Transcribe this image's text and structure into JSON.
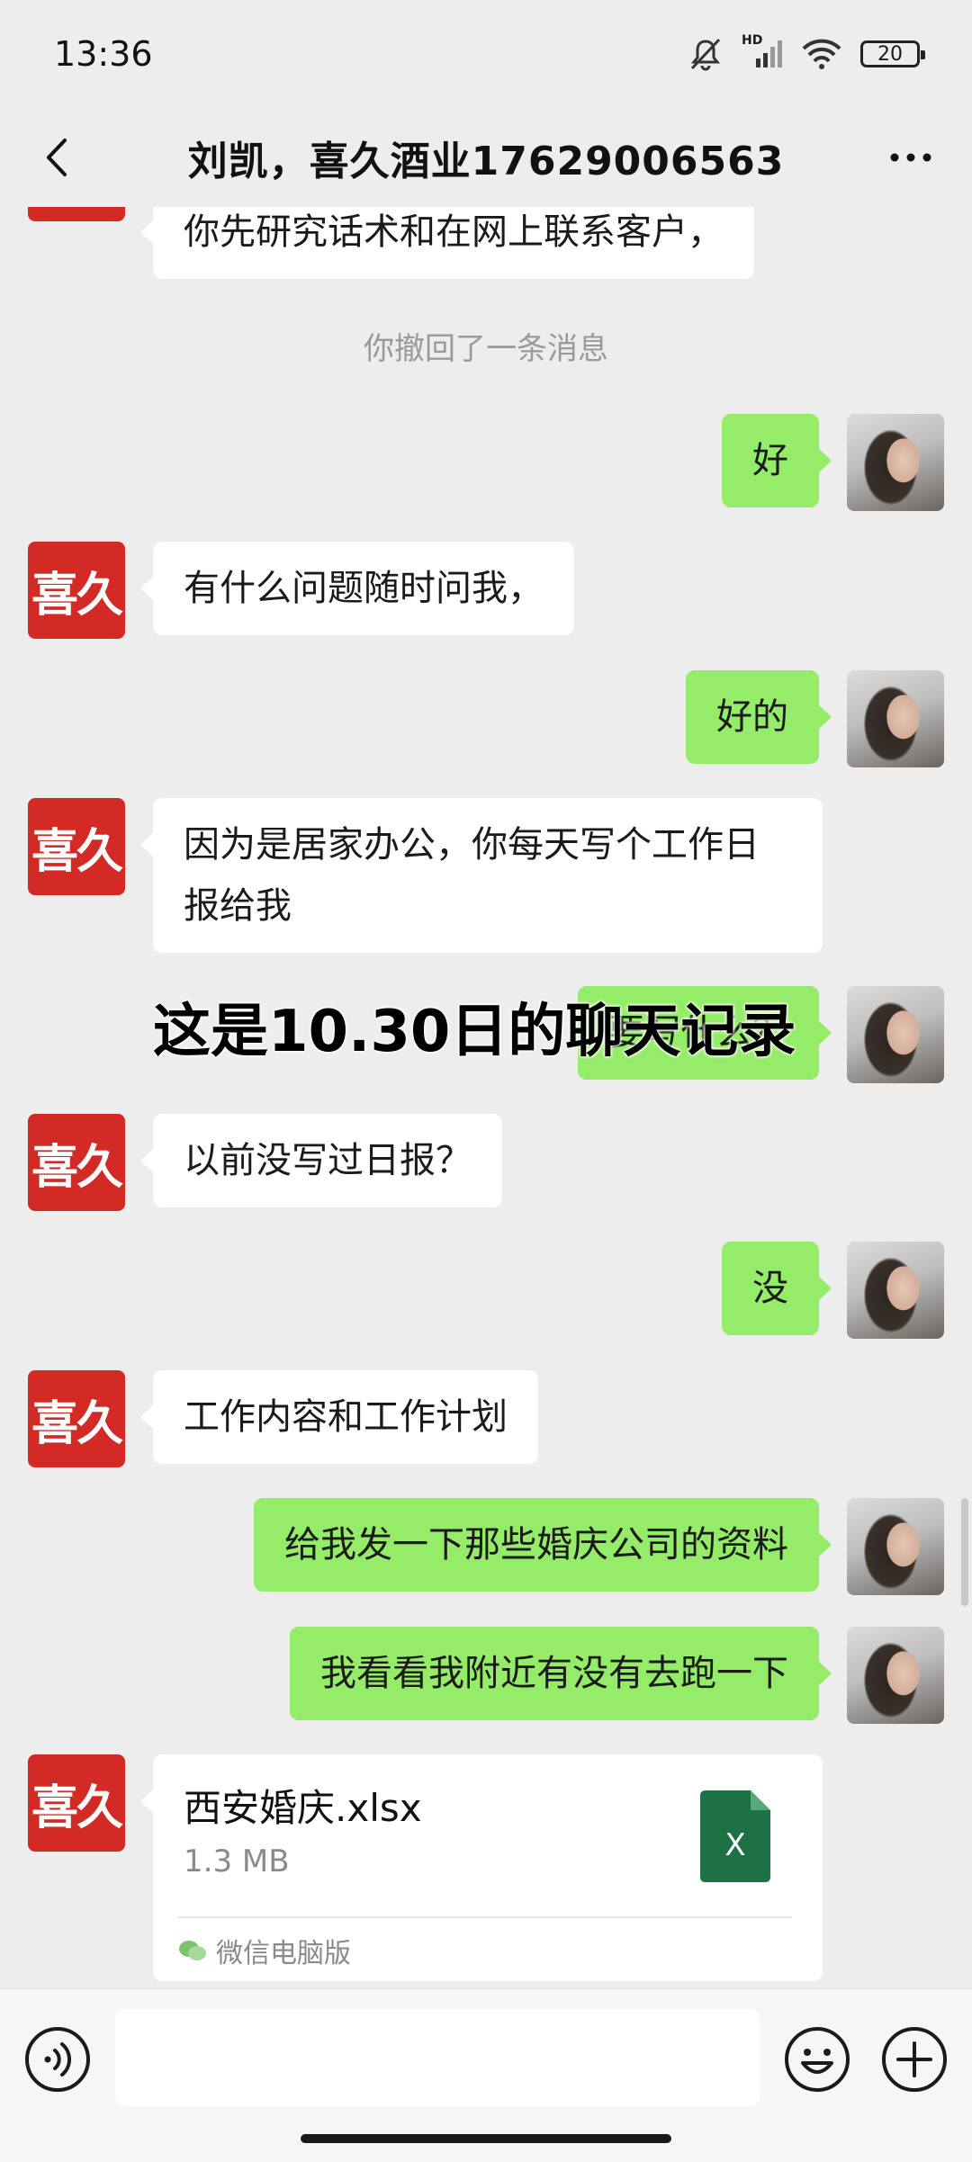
{
  "status_bar": {
    "time": "13:36",
    "network_label": "HD",
    "battery_level": "20",
    "icons": [
      "mute-icon",
      "signal-icon",
      "wifi-icon",
      "battery-icon"
    ]
  },
  "nav": {
    "title": "刘凯，喜久酒业17629006563",
    "back_icon": "chevron-left-icon",
    "more_icon": "more-dots-icon"
  },
  "contact_avatar_text": "喜久",
  "messages": [
    {
      "from": "other",
      "text": "你先研究话术和在网上联系客户，"
    },
    {
      "from": "system",
      "text": "你撤回了一条消息"
    },
    {
      "from": "me",
      "text": "好"
    },
    {
      "from": "other",
      "text": "有什么问题随时问我，"
    },
    {
      "from": "me",
      "text": "好的"
    },
    {
      "from": "other",
      "text": "因为是居家办公，你每天写个工作日报给我"
    },
    {
      "from": "me",
      "text": "要写什么？"
    },
    {
      "from": "other",
      "text": "以前没写过日报？"
    },
    {
      "from": "me",
      "text": "没"
    },
    {
      "from": "other",
      "text": "工作内容和工作计划"
    },
    {
      "from": "me",
      "text": "给我发一下那些婚庆公司的资料"
    },
    {
      "from": "me",
      "text": "我看看我附近有没有去跑一下"
    }
  ],
  "file_message": {
    "from": "other",
    "file_name": "西安婚庆.xlsx",
    "file_size": "1.3 MB",
    "file_icon_letter": "X",
    "source": "微信电脑版",
    "colors": {
      "excel": "#1e7145"
    }
  },
  "overlay_caption": "这是10.30日的聊天记录",
  "input_bar": {
    "placeholder": "",
    "voice_icon": "voice-icon",
    "emoji_icon": "emoji-icon",
    "plus_icon": "plus-icon"
  },
  "colors": {
    "background": "#ededed",
    "outgoing_bubble": "#95ec69",
    "incoming_bubble": "#ffffff",
    "contact_avatar": "#d42a26"
  }
}
